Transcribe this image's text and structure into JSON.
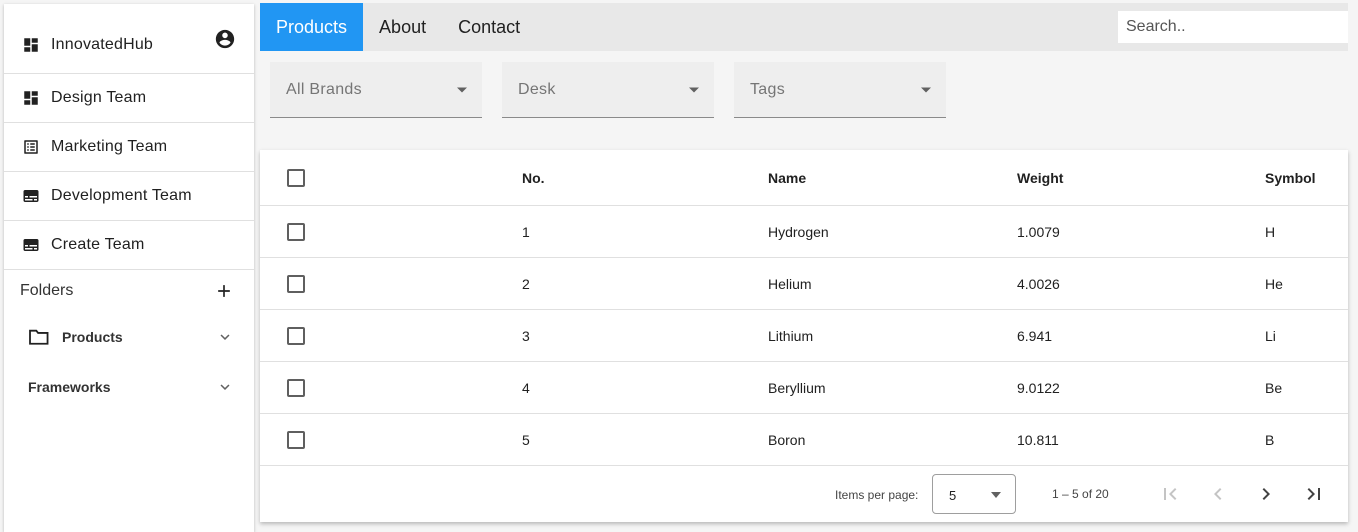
{
  "app": {
    "name": "InnovatedHub"
  },
  "sidebar": {
    "items": [
      {
        "label": "Design Team",
        "icon": "dashboard-icon"
      },
      {
        "label": "Marketing Team",
        "icon": "list-alt-icon"
      },
      {
        "label": "Development Team",
        "icon": "subtitles-icon"
      },
      {
        "label": "Create Team",
        "icon": "subtitles-icon"
      }
    ],
    "folders_label": "Folders",
    "folders": [
      {
        "label": "Products",
        "icon": "folder-icon"
      },
      {
        "label": "Frameworks"
      }
    ]
  },
  "nav": {
    "tabs": [
      {
        "label": "Products",
        "active": true
      },
      {
        "label": "About",
        "active": false
      },
      {
        "label": "Contact",
        "active": false
      }
    ],
    "search_placeholder": "Search.."
  },
  "filters": [
    {
      "label": "All Brands"
    },
    {
      "label": "Desk"
    },
    {
      "label": "Tags"
    }
  ],
  "table": {
    "headers": {
      "no": "No.",
      "name": "Name",
      "weight": "Weight",
      "symbol": "Symbol"
    },
    "rows": [
      {
        "no": "1",
        "name": "Hydrogen",
        "weight": "1.0079",
        "symbol": "H"
      },
      {
        "no": "2",
        "name": "Helium",
        "weight": "4.0026",
        "symbol": "He"
      },
      {
        "no": "3",
        "name": "Lithium",
        "weight": "6.941",
        "symbol": "Li"
      },
      {
        "no": "4",
        "name": "Beryllium",
        "weight": "9.0122",
        "symbol": "Be"
      },
      {
        "no": "5",
        "name": "Boron",
        "weight": "10.811",
        "symbol": "B"
      }
    ]
  },
  "paginator": {
    "items_per_page_label": "Items per page:",
    "page_size": "5",
    "range_label": "1 – 5 of 20"
  },
  "colors": {
    "accent": "#2196f3",
    "topbar": "#e8e8e8",
    "filter_bg": "#eeeeee"
  }
}
